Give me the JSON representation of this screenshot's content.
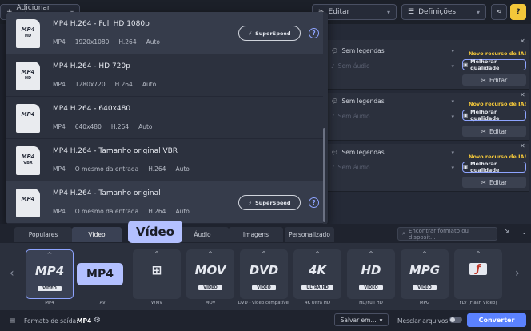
{
  "toolbar": {
    "add_label": "Adicionar mídia",
    "edit_label": "Editar",
    "settings_label": "Definições",
    "help_label": "?"
  },
  "file_rows": [
    {
      "subtitles": "Sem legendas",
      "audio": "Sem áudio",
      "ai_label": "Novo recurso de IA!",
      "quality_label": "Melhorar qualidade",
      "edit_label": "Editar"
    },
    {
      "subtitles": "Sem legendas",
      "audio": "Sem áudio",
      "ai_label": "Novo recurso de IA!",
      "quality_label": "Melhorar qualidade",
      "edit_label": "Editar"
    },
    {
      "subtitles": "Sem legendas",
      "audio": "Sem áudio",
      "ai_label": "Novo recurso de IA!",
      "quality_label": "Melhorar qualidade",
      "edit_label": "Editar"
    }
  ],
  "presets": [
    {
      "icon": "MP4",
      "icon_sub": "HD",
      "title": "MP4 H.264 - Full HD 1080p",
      "info": [
        "MP4",
        "1920x1080",
        "H.264",
        "Auto"
      ],
      "superspeed": "SuperSpeed",
      "selected": true
    },
    {
      "icon": "MP4",
      "icon_sub": "HD",
      "title": "MP4 H.264 - HD 720p",
      "info": [
        "MP4",
        "1280x720",
        "H.264",
        "Auto"
      ],
      "superspeed": "",
      "selected": false
    },
    {
      "icon": "MP4",
      "icon_sub": "",
      "title": "MP4 H.264 - 640x480",
      "info": [
        "MP4",
        "640x480",
        "H.264",
        "Auto"
      ],
      "superspeed": "",
      "selected": false
    },
    {
      "icon": "MP4",
      "icon_sub": "VBR",
      "title": "MP4 H.264 - Tamanho original VBR",
      "info": [
        "MP4",
        "O mesmo da entrada",
        "H.264",
        "Auto"
      ],
      "superspeed": "",
      "selected": false
    },
    {
      "icon": "MP4",
      "icon_sub": "",
      "title": "MP4 H.264 - Tamanho original",
      "info": [
        "MP4",
        "O mesmo da entrada",
        "H.264",
        "Auto"
      ],
      "superspeed": "SuperSpeed",
      "selected": true
    }
  ],
  "tabs": [
    {
      "label": "Populares",
      "active": false
    },
    {
      "label": "Vídeo",
      "active": true
    },
    {
      "label": "Áudio",
      "active": false
    },
    {
      "label": "Imagens",
      "active": false
    },
    {
      "label": "Personalizado",
      "active": false
    }
  ],
  "search_placeholder": "Encontrar formato ou disposit...",
  "tooltip_tab": "Vídeo",
  "tooltip_format": "MP4",
  "formats": [
    {
      "logo": "MP4",
      "band": "VIDEO",
      "label": "MP4",
      "selected": true
    },
    {
      "logo": "",
      "band": "",
      "label": "AVI",
      "selected": false
    },
    {
      "logo": "",
      "band": "",
      "label": "WMV",
      "selected": false
    },
    {
      "logo": "MOV",
      "band": "VIDEO",
      "label": "MOV",
      "selected": false
    },
    {
      "logo": "DVD",
      "band": "VIDEO",
      "label": "DVD - vídeo compatível",
      "selected": false
    },
    {
      "logo": "4K",
      "band": "ULTRA HD",
      "label": "4K Ultra HD",
      "selected": false
    },
    {
      "logo": "HD",
      "band": "VIDEO",
      "label": "HD/Full HD",
      "selected": false
    },
    {
      "logo": "MPG",
      "band": "VIDEO",
      "label": "MPG",
      "selected": false
    },
    {
      "logo": "",
      "band": "",
      "label": "FLV (Flash Vídeo)",
      "selected": false
    }
  ],
  "bottom": {
    "output_label": "Formato de saída:",
    "output_value": "MP4",
    "save_label": "Salvar em...",
    "merge_label": "Mesclar arquivos:",
    "convert_label": "Converter"
  },
  "colors": {
    "accent": "#5b82ff",
    "highlight": "#b3c0ff",
    "ia": "#f3c73a"
  }
}
